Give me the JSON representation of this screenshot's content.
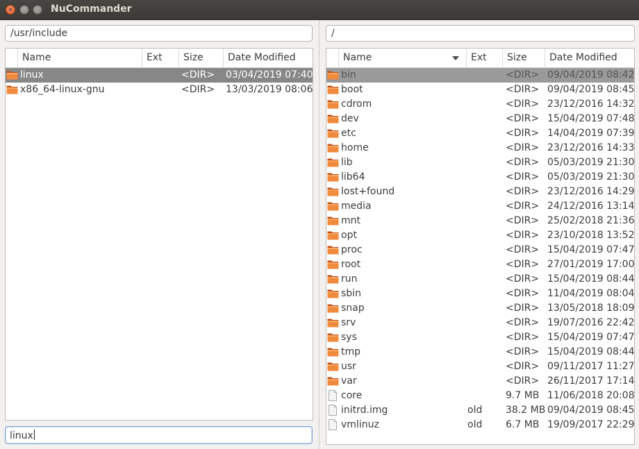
{
  "window": {
    "title": "NuCommander"
  },
  "left": {
    "path": "/usr/include",
    "headers": [
      "Name",
      "Ext",
      "Size",
      "Date Modified"
    ],
    "rows": [
      {
        "name": "linux",
        "ext": "",
        "size": "<DIR>",
        "date": "03/04/2019 07:40",
        "type": "folder"
      },
      {
        "name": "x86_64-linux-gnu",
        "ext": "",
        "size": "<DIR>",
        "date": "13/03/2019 08:06",
        "type": "folder"
      }
    ],
    "filter_value": "linux"
  },
  "right": {
    "path": "/",
    "headers": [
      "Name",
      "Ext",
      "Size",
      "Date Modified"
    ],
    "rows": [
      {
        "name": "bin",
        "ext": "",
        "size": "<DIR>",
        "date": "09/04/2019 08:42",
        "type": "folder"
      },
      {
        "name": "boot",
        "ext": "",
        "size": "<DIR>",
        "date": "09/04/2019 08:45",
        "type": "folder"
      },
      {
        "name": "cdrom",
        "ext": "",
        "size": "<DIR>",
        "date": "23/12/2016 14:32",
        "type": "folder"
      },
      {
        "name": "dev",
        "ext": "",
        "size": "<DIR>",
        "date": "15/04/2019 07:48",
        "type": "folder"
      },
      {
        "name": "etc",
        "ext": "",
        "size": "<DIR>",
        "date": "14/04/2019 07:39",
        "type": "folder"
      },
      {
        "name": "home",
        "ext": "",
        "size": "<DIR>",
        "date": "23/12/2016 14:33",
        "type": "folder"
      },
      {
        "name": "lib",
        "ext": "",
        "size": "<DIR>",
        "date": "05/03/2019 21:30",
        "type": "folder"
      },
      {
        "name": "lib64",
        "ext": "",
        "size": "<DIR>",
        "date": "05/03/2019 21:30",
        "type": "folder"
      },
      {
        "name": "lost+found",
        "ext": "",
        "size": "<DIR>",
        "date": "23/12/2016 14:29",
        "type": "folder"
      },
      {
        "name": "media",
        "ext": "",
        "size": "<DIR>",
        "date": "24/12/2016 13:14",
        "type": "folder"
      },
      {
        "name": "mnt",
        "ext": "",
        "size": "<DIR>",
        "date": "25/02/2018 21:36",
        "type": "folder"
      },
      {
        "name": "opt",
        "ext": "",
        "size": "<DIR>",
        "date": "23/10/2018 13:52",
        "type": "folder"
      },
      {
        "name": "proc",
        "ext": "",
        "size": "<DIR>",
        "date": "15/04/2019 07:47",
        "type": "folder"
      },
      {
        "name": "root",
        "ext": "",
        "size": "<DIR>",
        "date": "27/01/2019 17:00",
        "type": "folder"
      },
      {
        "name": "run",
        "ext": "",
        "size": "<DIR>",
        "date": "15/04/2019 08:44",
        "type": "folder"
      },
      {
        "name": "sbin",
        "ext": "",
        "size": "<DIR>",
        "date": "11/04/2019 08:04",
        "type": "folder"
      },
      {
        "name": "snap",
        "ext": "",
        "size": "<DIR>",
        "date": "13/05/2018 18:09",
        "type": "folder"
      },
      {
        "name": "srv",
        "ext": "",
        "size": "<DIR>",
        "date": "19/07/2016 22:42",
        "type": "folder"
      },
      {
        "name": "sys",
        "ext": "",
        "size": "<DIR>",
        "date": "15/04/2019 07:47",
        "type": "folder"
      },
      {
        "name": "tmp",
        "ext": "",
        "size": "<DIR>",
        "date": "15/04/2019 08:44",
        "type": "folder"
      },
      {
        "name": "usr",
        "ext": "",
        "size": "<DIR>",
        "date": "09/11/2017 11:27",
        "type": "folder"
      },
      {
        "name": "var",
        "ext": "",
        "size": "<DIR>",
        "date": "26/11/2017 17:14",
        "type": "folder"
      },
      {
        "name": "core",
        "ext": "",
        "size": "9.7 MB",
        "date": "11/06/2018 20:08",
        "type": "file"
      },
      {
        "name": "initrd.img",
        "ext": "old",
        "size": "38.2 MB",
        "date": "09/04/2019 08:45",
        "type": "file"
      },
      {
        "name": "vmlinuz",
        "ext": "old",
        "size": "6.7 MB",
        "date": "19/09/2017 22:29",
        "type": "file"
      }
    ]
  },
  "colors": {
    "selection": "#878787",
    "folder": "#e8702a",
    "titlebar": "#3f3e3a"
  },
  "icons": {
    "folder": "folder-icon",
    "file": "file-icon"
  }
}
